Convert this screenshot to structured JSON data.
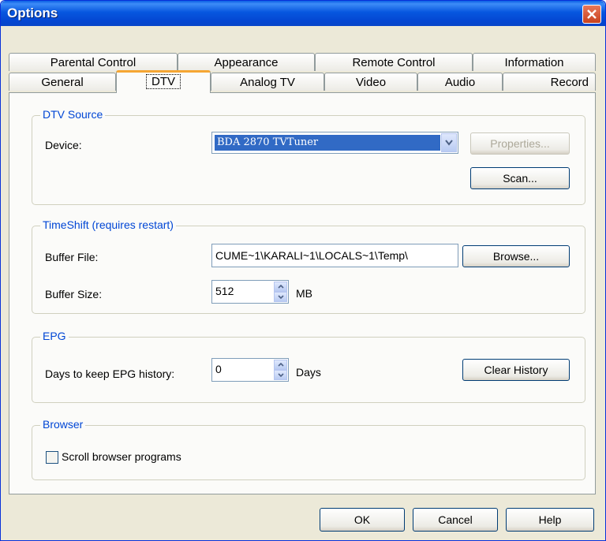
{
  "window": {
    "title": "Options"
  },
  "tabs_back": [
    "Parental Control",
    "Appearance",
    "Remote Control",
    "Information"
  ],
  "tabs_front": [
    "General",
    "DTV",
    "Analog TV",
    "Video",
    "Audio",
    "Record"
  ],
  "active_tab": "DTV",
  "dtv_source": {
    "title": "DTV Source",
    "device_label": "Device:",
    "device_value": "BDA 2870 TVTuner",
    "properties_button": "Properties...",
    "scan_button": "Scan..."
  },
  "timeshift": {
    "title": "TimeShift (requires restart)",
    "buffer_file_label": "Buffer File:",
    "buffer_file_value": "CUME~1\\KARALI~1\\LOCALS~1\\Temp\\",
    "browse_button": "Browse...",
    "buffer_size_label": "Buffer Size:",
    "buffer_size_value": "512",
    "buffer_size_unit": "MB"
  },
  "epg": {
    "title": "EPG",
    "days_label": "Days to keep EPG history:",
    "days_value": "0",
    "days_unit": "Days",
    "clear_button": "Clear History"
  },
  "browser": {
    "title": "Browser",
    "scroll_label": "Scroll browser programs",
    "scroll_checked": false
  },
  "footer": {
    "ok": "OK",
    "cancel": "Cancel",
    "help": "Help"
  },
  "colors": {
    "title_blue": "#0757df",
    "group_title": "#0046d5",
    "active_tab_accent": "#f5a633",
    "selection": "#316ac5"
  }
}
